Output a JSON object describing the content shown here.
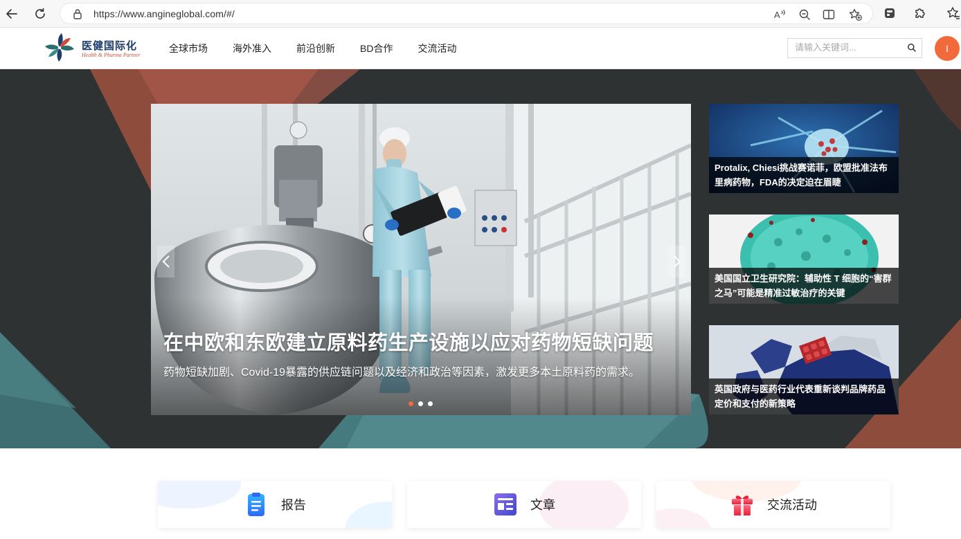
{
  "browser": {
    "url": "https://www.angineglobal.com/#/"
  },
  "header": {
    "logo_cn": "医健国际化",
    "logo_en": "Health & Pharma Partner",
    "nav": [
      "全球市场",
      "海外准入",
      "前沿创新",
      "BD合作",
      "交流活动"
    ],
    "search_placeholder": "请输入关键词...",
    "avatar_letter": "I"
  },
  "hero": {
    "slide": {
      "title": "在中欧和东欧建立原料药生产设施以应对药物短缺问题",
      "description": "药物短缺加剧、Covid-19暴露的供应链问题以及经济和政治等因素，激发更多本土原料药的需求。",
      "count": 3,
      "active": 0
    },
    "side_news": [
      {
        "title": "Protalix, Chiesi挑战赛诺菲，欧盟批准法布里病药物，FDA的决定迫在眉睫",
        "image": "neuron-illustration"
      },
      {
        "title": "美国国立卫生研究院：辅助性 T 细胞的“害群之马”可能是精准过敏治疗的关键",
        "image": "cell-illustration"
      },
      {
        "title": "英国政府与医药行业代表重新谈判品牌药品定价和支付的新策略",
        "image": "europe-map-pills"
      }
    ]
  },
  "categories": [
    {
      "label": "报告",
      "icon": "clipboard-icon",
      "color": "#2f8cf5"
    },
    {
      "label": "文章",
      "icon": "article-icon",
      "color": "#5a4fd1"
    },
    {
      "label": "交流活动",
      "icon": "gift-icon",
      "color": "#f23a5a"
    }
  ],
  "colors": {
    "accent": "#f06a3b",
    "hero_bg": "#2e3233",
    "teal": "#3f7d80",
    "rust": "#b6604a"
  }
}
